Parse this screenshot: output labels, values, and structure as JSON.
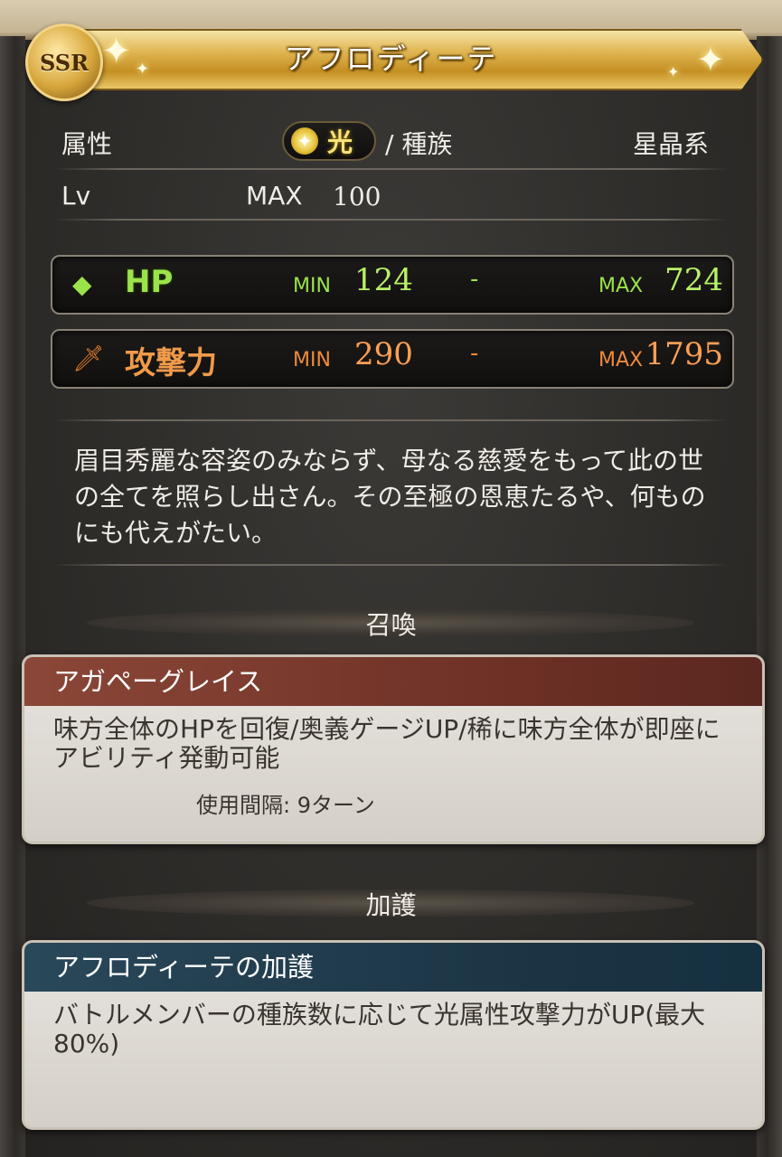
{
  "header": {
    "rarity": "SSR",
    "name": "アフロディーテ"
  },
  "attributes": {
    "element_label": "属性",
    "element_value": "光",
    "race_label": "/ 種族",
    "race_value": "星晶系"
  },
  "level": {
    "label": "Lv",
    "max_label": "MAX",
    "max_value": "100"
  },
  "stats": {
    "hp": {
      "name": "HP",
      "min_label": "MIN",
      "min_value": "124",
      "sep": "-",
      "max_label": "MAX",
      "max_value": "724",
      "icon": "green-diamond-icon",
      "color": "#9be34a"
    },
    "atk": {
      "name": "攻撃力",
      "min_label": "MIN",
      "min_value": "290",
      "sep": "-",
      "max_label": "MAX",
      "max_value": "1795",
      "icon": "sword-icon",
      "color": "#f09a4a"
    }
  },
  "flavor_text": "眉目秀麗な容姿のみならず、母なる慈愛をもって此の世の全てを照らし出さん。その至極の恩恵たるや、何ものにも代えがたい。",
  "summon": {
    "section_title": "召喚",
    "name": "アガペーグレイス",
    "description": "味方全体のHPを回復/奥義ゲージUP/稀に味方全体が即座にアビリティ発動可能",
    "cooldown": "使用間隔: 9ターン"
  },
  "aura": {
    "section_title": "加護",
    "name": "アフロディーテの加護",
    "description": "バトルメンバーの種族数に応じて光属性攻撃力がUP(最大80%)"
  }
}
